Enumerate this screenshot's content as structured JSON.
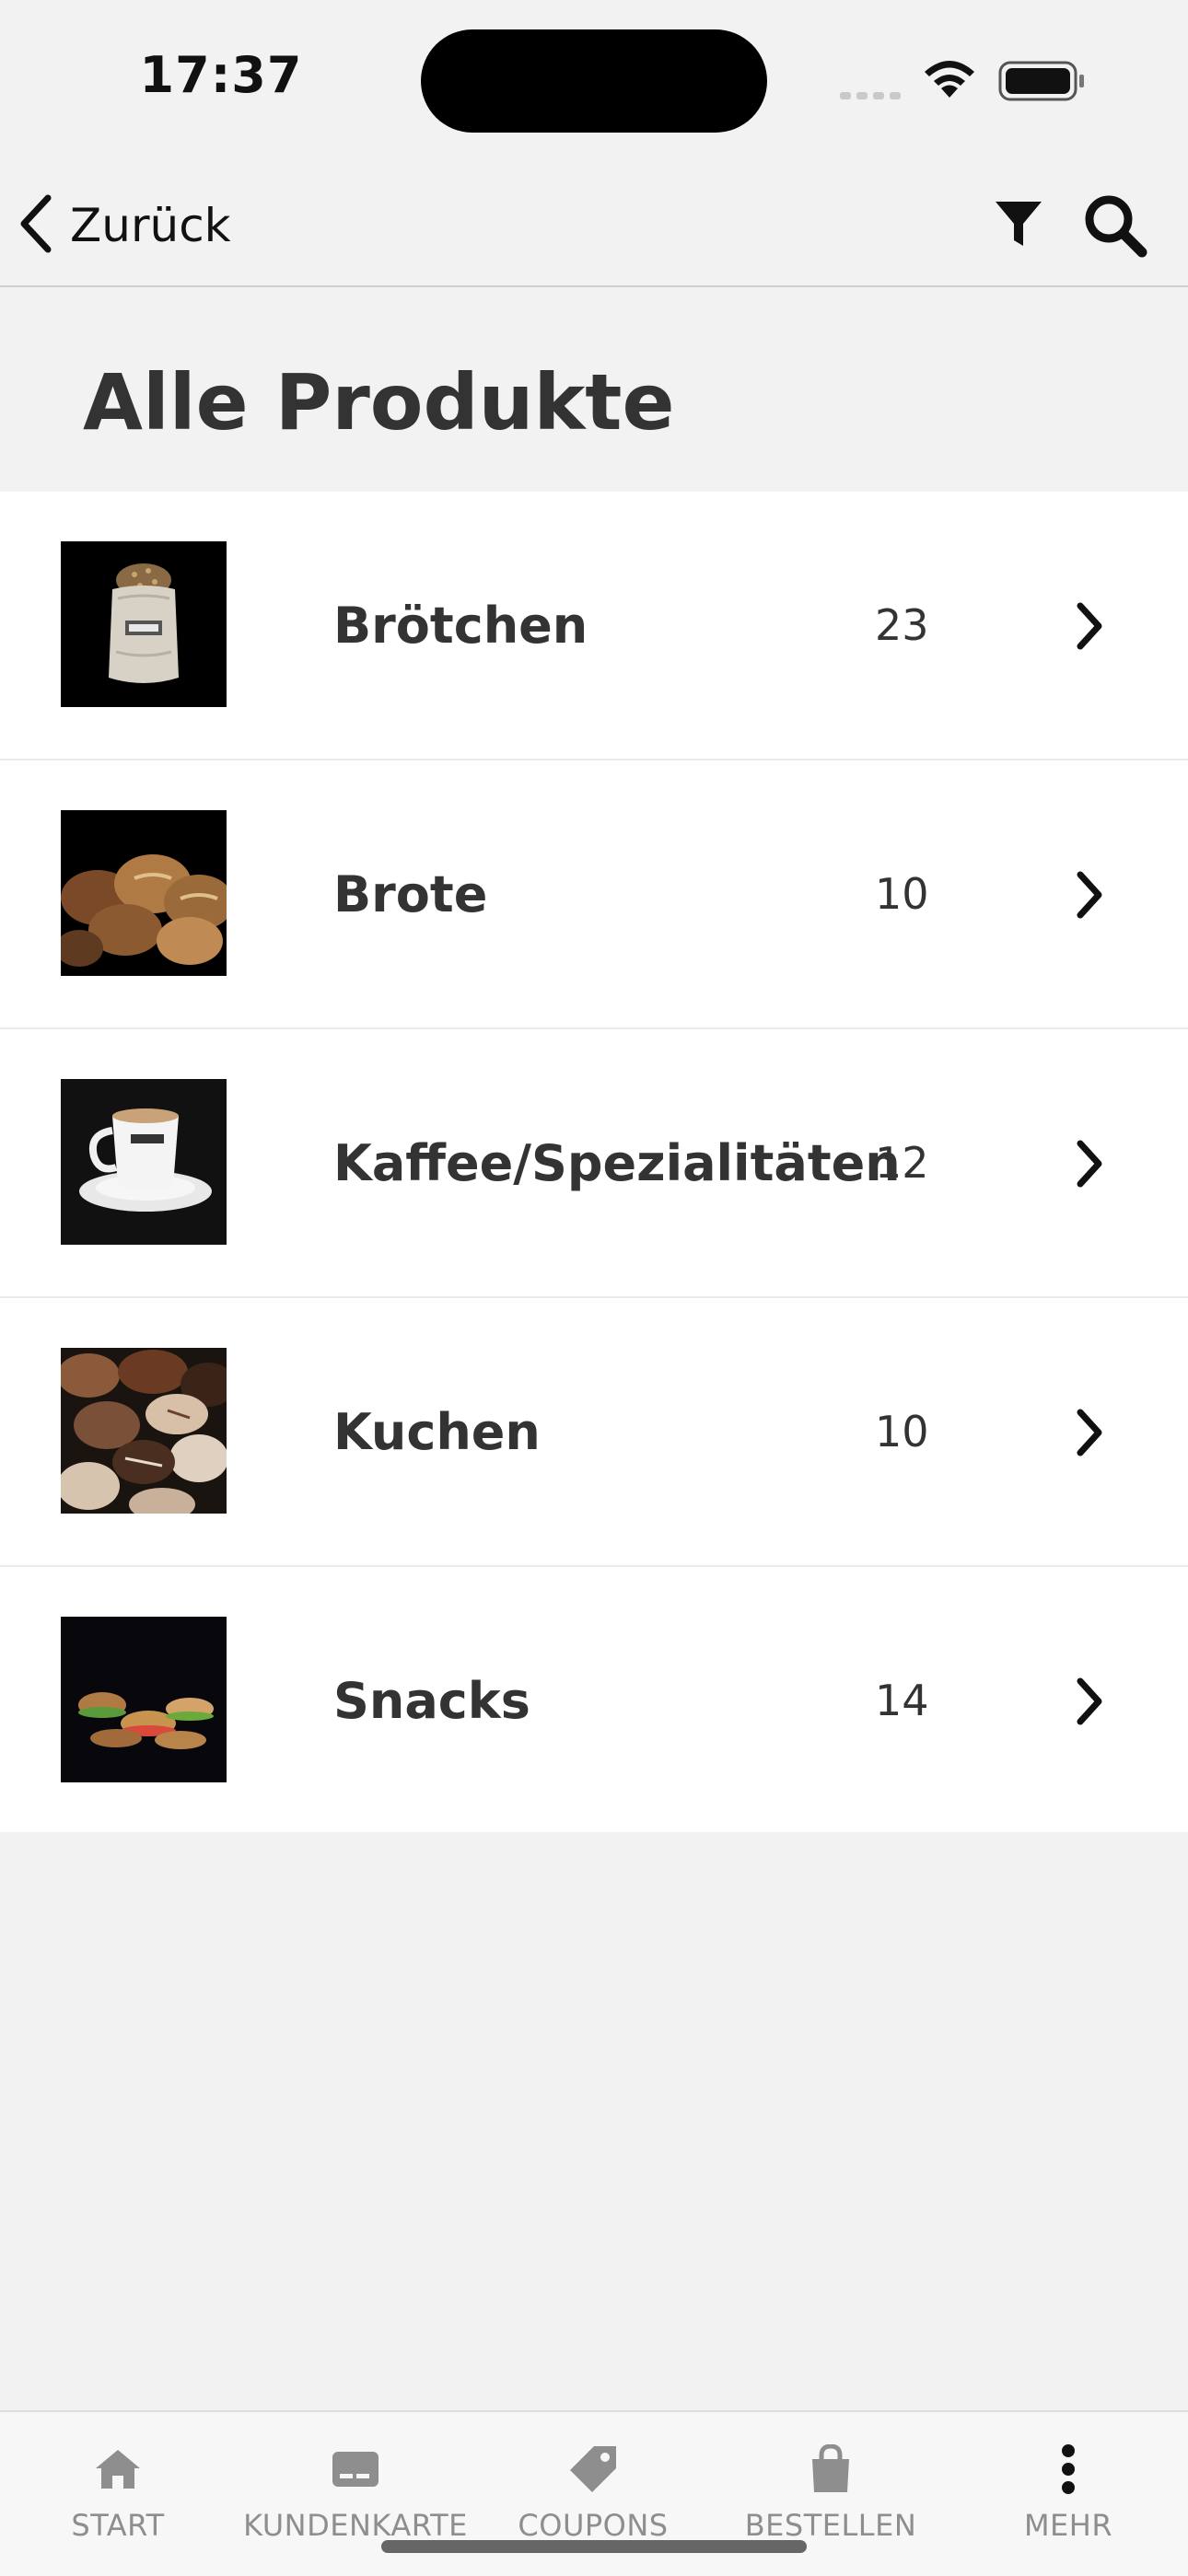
{
  "status_bar": {
    "time": "17:37"
  },
  "nav": {
    "back_label": "Zurück",
    "icons": [
      "chevron-left-icon",
      "filter-icon",
      "search-icon"
    ]
  },
  "page": {
    "title": "Alle Produkte"
  },
  "categories": [
    {
      "name": "Brötchen",
      "count": "23",
      "image": "bread-rolls-bag-photo"
    },
    {
      "name": "Brote",
      "count": "10",
      "image": "bread-loaves-photo"
    },
    {
      "name": "Kaffee/Spezialitäten",
      "count": "12",
      "image": "coffee-cup-photo"
    },
    {
      "name": "Kuchen",
      "count": "10",
      "image": "pastries-photo"
    },
    {
      "name": "Snacks",
      "count": "14",
      "image": "sandwiches-photo"
    }
  ],
  "tabbar": {
    "tabs": [
      {
        "label": "START",
        "icon": "home-icon"
      },
      {
        "label": "KUNDENKARTE",
        "icon": "card-icon"
      },
      {
        "label": "COUPONS",
        "icon": "tag-icon"
      },
      {
        "label": "BESTELLEN",
        "icon": "bag-icon"
      },
      {
        "label": "MEHR",
        "icon": "more-vertical-icon"
      }
    ]
  },
  "colors": {
    "background": "#f2f2f2",
    "list_background": "#ffffff",
    "text": "#333333",
    "tab_inactive": "#8e8e8e"
  }
}
